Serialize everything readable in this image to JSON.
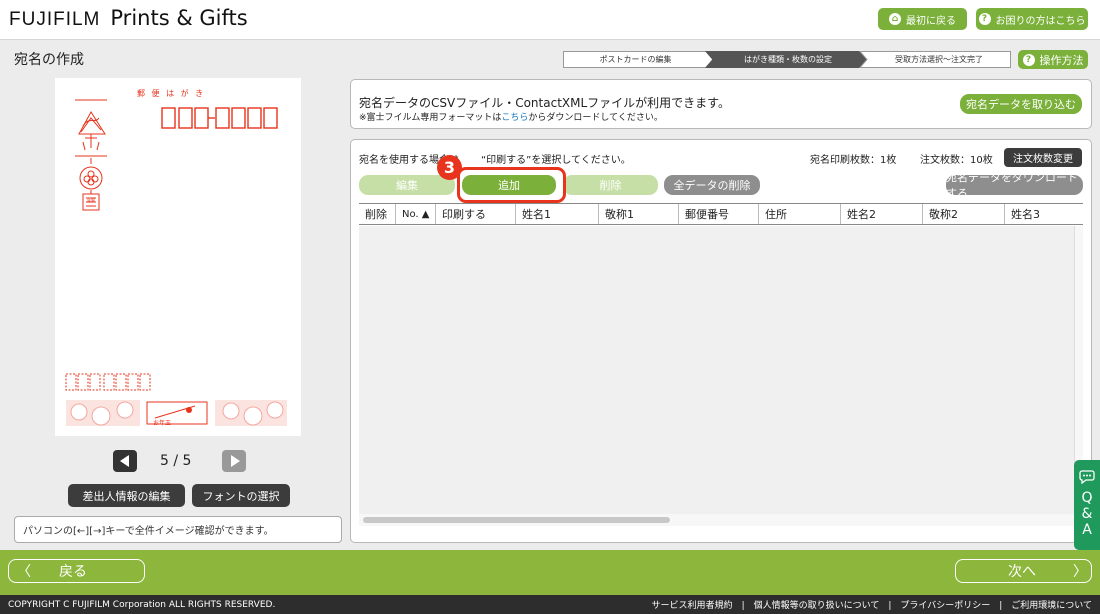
{
  "header": {
    "brand": "FUJIFILM",
    "product": "Prints & Gifts",
    "home_button": "最初に戻る",
    "help_button": "お困りの方はこちら"
  },
  "page": {
    "title": "宛名の作成",
    "how_to_button": "操作方法"
  },
  "steps": [
    {
      "label": "ポストカードの編集",
      "active": false
    },
    {
      "label": "はがき種類・枚数の設定",
      "active": true
    },
    {
      "label": "受取方法選択〜注文完了",
      "active": false
    }
  ],
  "postcard": {
    "header_text": "郵 便 は が き",
    "stamp_label": "年賀",
    "lottery_label": "お年玉"
  },
  "pager": {
    "text": "5 / 5"
  },
  "left_actions": {
    "sender_button": "差出人情報の編集",
    "font_button": "フォントの選択"
  },
  "hint": "パソコンの[←][→]キーで全件イメージ確認ができます。",
  "csv": {
    "line1": "宛名データのCSVファイル・ContactXMLファイルが利用できます。",
    "line2_prefix": "※富士フイルム専用フォーマットは",
    "line2_link": "こちら",
    "line2_suffix": "からダウンロードしてください。",
    "import_button": "宛名データを取り込む"
  },
  "list": {
    "instruction_before": "宛名を使用する場合は",
    "instruction_after": "“印刷する”を選択してください。",
    "print_count_label": "宛名印刷枚数：1枚",
    "order_count_label": "注文枚数：10枚",
    "change_order_button": "注文枚数変更",
    "edit_button": "編集",
    "add_button": "追加",
    "delete_button": "削除",
    "delete_all_button": "全データの削除",
    "download_button": "宛名データをダウンロードする",
    "columns": [
      "削除",
      "No. ▲",
      "印刷する",
      "姓名1",
      "敬称1",
      "郵便番号",
      "住所",
      "姓名2",
      "敬称2",
      "姓名3"
    ]
  },
  "annotation": {
    "step_number": "3"
  },
  "qa": {
    "label": "Q&A"
  },
  "nav": {
    "back_button": "戻る",
    "next_button": "次へ"
  },
  "footer": {
    "copyright": "COPYRIGHT C FUJIFILM Corporation ALL RIGHTS RESERVED.",
    "links": [
      "サービス利用者規約",
      "個人情報等の取り扱いについて",
      "プライバシーポリシー",
      "ご利用環境について"
    ]
  },
  "colors": {
    "accent_green": "#7bb03a",
    "bottom_bar": "#8cb63c",
    "annotation_red": "#e8331d",
    "stamp_red": "#e8331d",
    "qa_green": "#1f9a5c"
  }
}
